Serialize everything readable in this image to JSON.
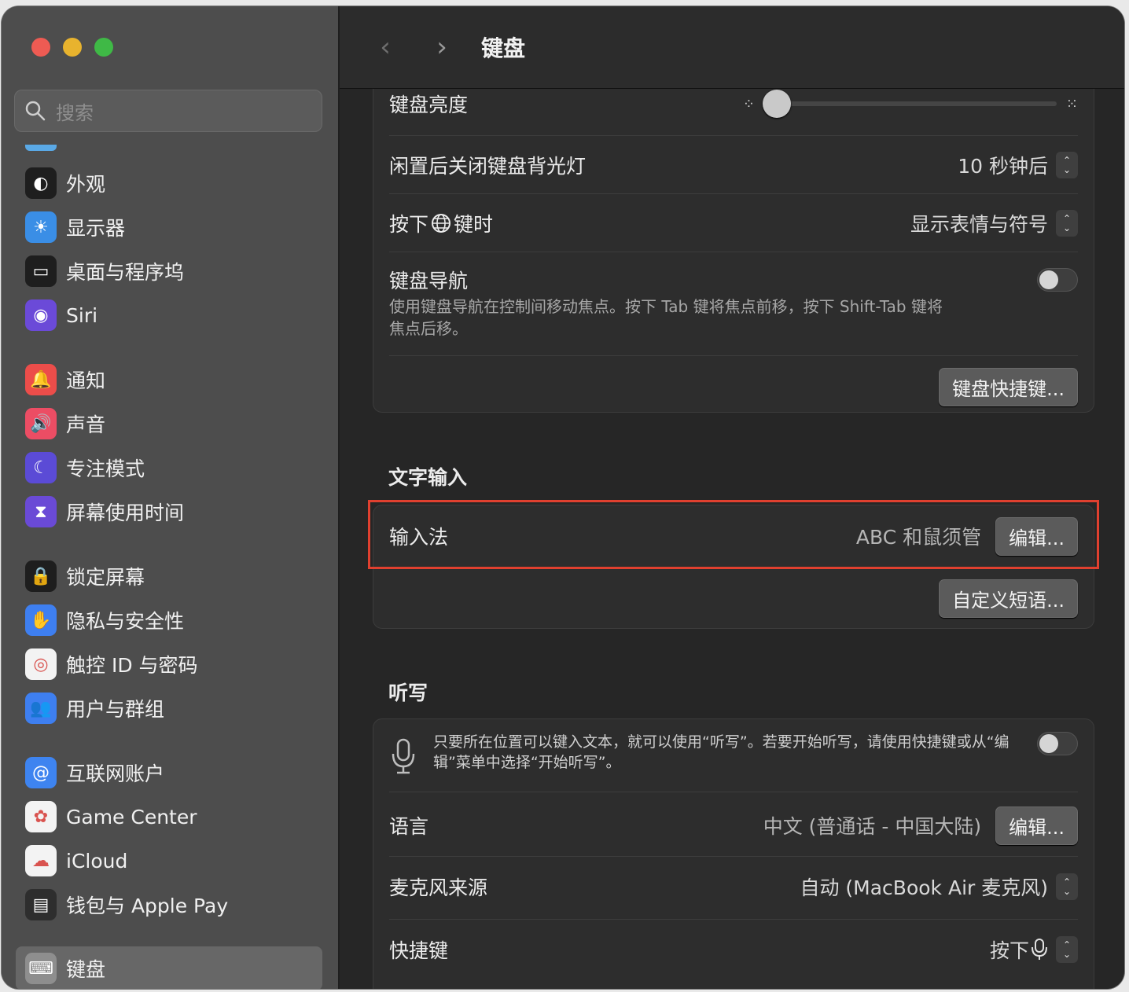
{
  "window": {
    "title": "键盘"
  },
  "search": {
    "placeholder": "搜索"
  },
  "sidebar": {
    "items": [
      {
        "label": "外观",
        "icon": "appearance-icon",
        "color": "#1e1e1e"
      },
      {
        "label": "显示器",
        "icon": "brightness-icon",
        "color": "#3a8ee6"
      },
      {
        "label": "桌面与程序坞",
        "icon": "dock-icon",
        "color": "#1e1e1e"
      },
      {
        "label": "Siri",
        "icon": "siri-icon",
        "color": "#6b4ad8"
      },
      {
        "label": "通知",
        "icon": "bell-icon",
        "color": "#ec4d4a"
      },
      {
        "label": "声音",
        "icon": "speaker-icon",
        "color": "#ec4d64"
      },
      {
        "label": "专注模式",
        "icon": "moon-icon",
        "color": "#5b4bd6"
      },
      {
        "label": "屏幕使用时间",
        "icon": "hourglass-icon",
        "color": "#6a4ad6"
      },
      {
        "label": "锁定屏幕",
        "icon": "lock-icon",
        "color": "#1e1e1e"
      },
      {
        "label": "隐私与安全性",
        "icon": "hand-icon",
        "color": "#3e7ff0"
      },
      {
        "label": "触控 ID 与密码",
        "icon": "fingerprint-icon",
        "color": "#f3f3f3"
      },
      {
        "label": "用户与群组",
        "icon": "users-icon",
        "color": "#3e7ff0"
      },
      {
        "label": "互联网账户",
        "icon": "at-icon",
        "color": "#3e84f0"
      },
      {
        "label": "Game Center",
        "icon": "game-center-icon",
        "color": "#f3f3f3"
      },
      {
        "label": "iCloud",
        "icon": "cloud-icon",
        "color": "#f3f3f3"
      },
      {
        "label": "钱包与 Apple Pay",
        "icon": "wallet-icon",
        "color": "#2e2e2e"
      },
      {
        "label": "键盘",
        "icon": "keyboard-icon",
        "color": "#8e8e8e"
      }
    ]
  },
  "keyboard": {
    "brightness_label": "键盘亮度",
    "brightness_level": 0.0,
    "backlight_off_label": "闲置后关闭键盘背光灯",
    "backlight_off_value": "10 秒钟后",
    "globe_label_pre": "按下",
    "globe_label_post": "键时",
    "globe_value": "显示表情与符号",
    "nav_label": "键盘导航",
    "nav_desc": "使用键盘导航在控制间移动焦点。按下 Tab 键将焦点前移，按下 Shift-Tab 键将焦点后移。",
    "nav_on": false,
    "shortcuts_button": "键盘快捷键..."
  },
  "text_input": {
    "title": "文字输入",
    "input_label": "输入法",
    "input_value": "ABC 和鼠须管",
    "edit_button": "编辑...",
    "replace_button": "自定义短语..."
  },
  "dictation": {
    "title": "听写",
    "desc": "只要所在位置可以键入文本，就可以使用“听写”。若要开始听写，请使用快捷键或从“编辑”菜单中选择“开始听写”。",
    "on": false,
    "language_label": "语言",
    "language_value": "中文 (普通话 - 中国大陆)",
    "language_edit": "编辑...",
    "mic_label": "麦克风来源",
    "mic_value": "自动 (MacBook Air 麦克风)",
    "shortcut_label": "快捷键",
    "shortcut_value": "按下"
  },
  "colors": {
    "highlight": "#e0402f"
  }
}
